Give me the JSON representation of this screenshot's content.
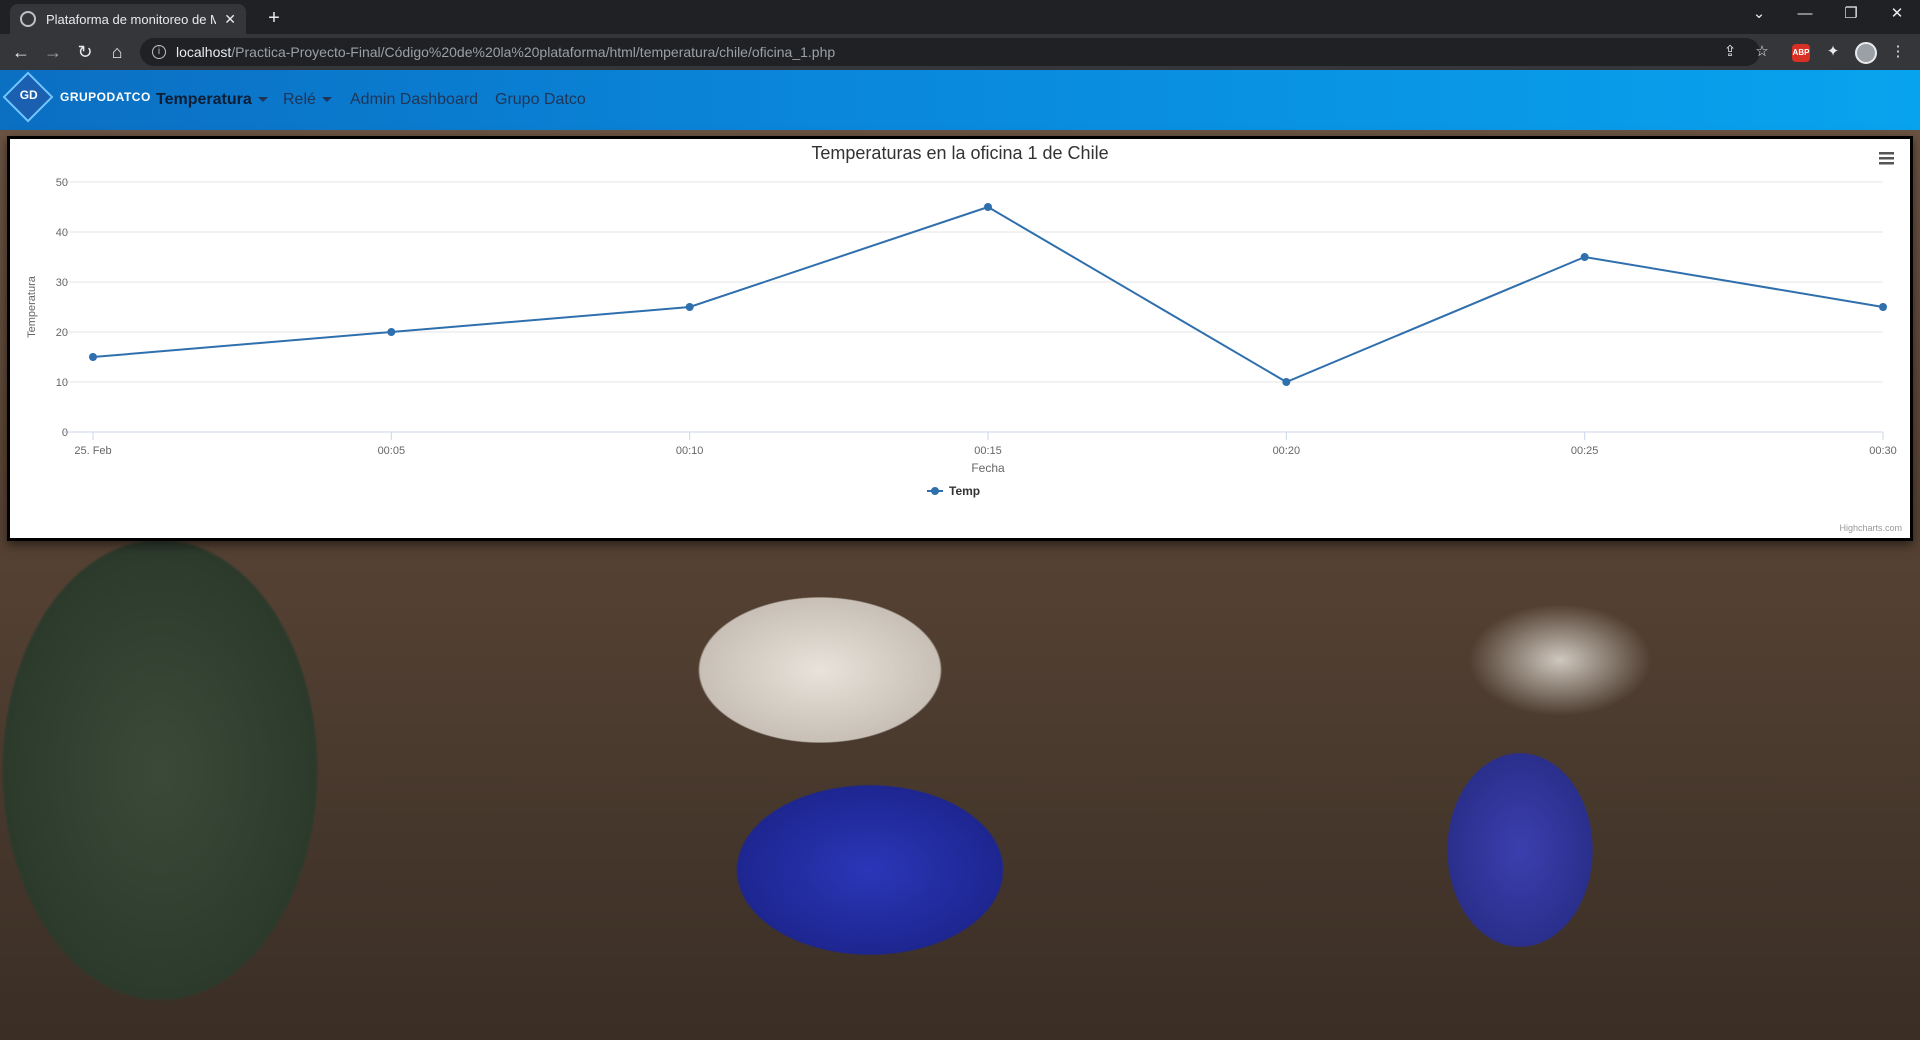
{
  "browser": {
    "tab_title": "Plataforma de monitoreo de MQ",
    "url_host": "localhost",
    "url_path": "/Practica-Proyecto-Final/Código%20de%20la%20plataforma/html/temperatura/chile/oficina_1.php",
    "abp_badge": "ABP"
  },
  "navbar": {
    "brand": "GRUPODATCO",
    "logo_text": "GD",
    "items": [
      {
        "label": "Temperatura",
        "dropdown": true,
        "active": true
      },
      {
        "label": "Relé",
        "dropdown": true,
        "active": false
      },
      {
        "label": "Admin Dashboard",
        "dropdown": false,
        "active": false
      },
      {
        "label": "Grupo Datco",
        "dropdown": false,
        "active": false
      }
    ]
  },
  "chart_data": {
    "type": "line",
    "title": "Temperaturas en la oficina 1 de Chile",
    "xlabel": "Fecha",
    "ylabel": "Temperatura",
    "categories": [
      "25. Feb",
      "00:05",
      "00:10",
      "00:15",
      "00:20",
      "00:25",
      "00:30"
    ],
    "yticks": [
      0,
      10,
      20,
      30,
      40,
      50
    ],
    "ylim": [
      0,
      50
    ],
    "series": [
      {
        "name": "Temp",
        "color": "#2f6fad",
        "values": [
          15,
          20,
          25,
          45,
          10,
          35,
          25
        ]
      }
    ],
    "grid": true,
    "legend": "bottom-center",
    "credits": "Highcharts.com"
  }
}
